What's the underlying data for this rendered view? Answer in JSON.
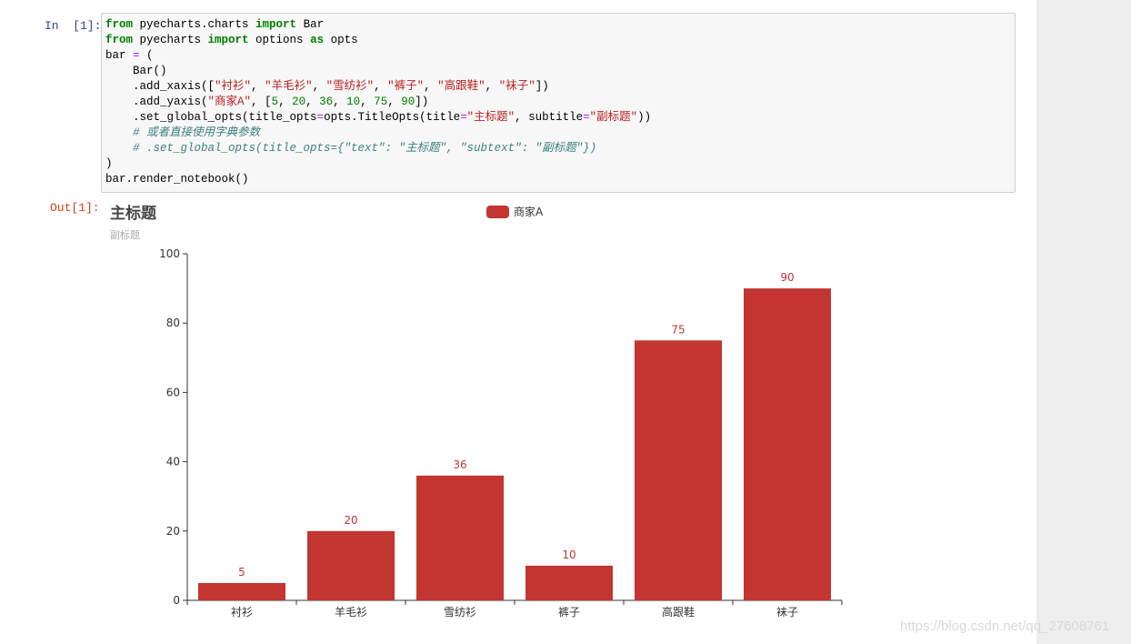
{
  "notebook": {
    "in_prompt": "In  [1]:",
    "out_prompt": "Out[1]:",
    "code_lines": [
      [
        [
          "kw",
          "from"
        ],
        [
          "t",
          " pyecharts.charts "
        ],
        [
          "kw",
          "import"
        ],
        [
          "t",
          " Bar"
        ]
      ],
      [
        [
          "kw",
          "from"
        ],
        [
          "t",
          " pyecharts "
        ],
        [
          "kw",
          "import"
        ],
        [
          "t",
          " options "
        ],
        [
          "kw",
          "as"
        ],
        [
          "t",
          " opts"
        ]
      ],
      [
        [
          "t",
          "bar "
        ],
        [
          "op",
          "="
        ],
        [
          "t",
          " ("
        ]
      ],
      [
        [
          "t",
          "    Bar()"
        ]
      ],
      [
        [
          "t",
          "    .add_xaxis(["
        ],
        [
          "str",
          "\"衬衫\""
        ],
        [
          "t",
          ", "
        ],
        [
          "str",
          "\"羊毛衫\""
        ],
        [
          "t",
          ", "
        ],
        [
          "str",
          "\"雪纺衫\""
        ],
        [
          "t",
          ", "
        ],
        [
          "str",
          "\"裤子\""
        ],
        [
          "t",
          ", "
        ],
        [
          "str",
          "\"高跟鞋\""
        ],
        [
          "t",
          ", "
        ],
        [
          "str",
          "\"袜子\""
        ],
        [
          "t",
          "])"
        ]
      ],
      [
        [
          "t",
          "    .add_yaxis("
        ],
        [
          "str",
          "\"商家A\""
        ],
        [
          "t",
          ", ["
        ],
        [
          "num",
          "5"
        ],
        [
          "t",
          ", "
        ],
        [
          "num",
          "20"
        ],
        [
          "t",
          ", "
        ],
        [
          "num",
          "36"
        ],
        [
          "t",
          ", "
        ],
        [
          "num",
          "10"
        ],
        [
          "t",
          ", "
        ],
        [
          "num",
          "75"
        ],
        [
          "t",
          ", "
        ],
        [
          "num",
          "90"
        ],
        [
          "t",
          "])"
        ]
      ],
      [
        [
          "t",
          "    .set_global_opts(title_opts"
        ],
        [
          "op",
          "="
        ],
        [
          "t",
          "opts.TitleOpts(title"
        ],
        [
          "op",
          "="
        ],
        [
          "str",
          "\"主标题\""
        ],
        [
          "t",
          ", subtitle"
        ],
        [
          "op",
          "="
        ],
        [
          "str",
          "\"副标题\""
        ],
        [
          "t",
          "))"
        ]
      ],
      [
        [
          "cm",
          "    # 或者直接使用字典参数"
        ]
      ],
      [
        [
          "cm",
          "    # .set_global_opts(title_opts={\"text\": \"主标题\", \"subtext\": \"副标题\"})"
        ]
      ],
      [
        [
          "t",
          ")"
        ]
      ],
      [
        [
          "t",
          "bar.render_notebook()"
        ]
      ]
    ]
  },
  "chart_data": {
    "type": "bar",
    "title": "主标题",
    "subtitle": "副标题",
    "categories": [
      "衬衫",
      "羊毛衫",
      "雪纺衫",
      "裤子",
      "高跟鞋",
      "袜子"
    ],
    "series": [
      {
        "name": "商家A",
        "values": [
          5,
          20,
          36,
          10,
          75,
          90
        ],
        "color": "#c23531"
      }
    ],
    "ylim": [
      0,
      100
    ],
    "yticks": [
      0,
      20,
      40,
      60,
      80,
      100
    ],
    "legend_position": "top-center",
    "grid": false
  },
  "watermark": "https://blog.csdn.net/qq_27608761"
}
